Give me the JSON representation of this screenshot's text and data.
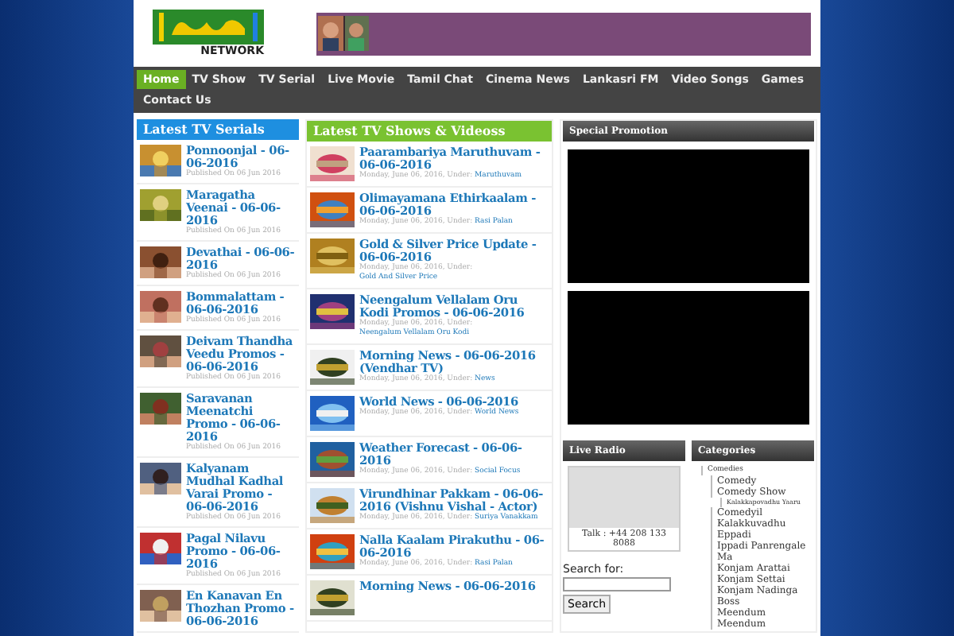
{
  "logo": {
    "subtitle": "NETWORK"
  },
  "nav": [
    {
      "label": "Home",
      "selected": true
    },
    {
      "label": "TV Show",
      "selected": false
    },
    {
      "label": "TV Serial",
      "selected": false
    },
    {
      "label": "Live Movie",
      "selected": false
    },
    {
      "label": "Tamil Chat",
      "selected": false
    },
    {
      "label": "Cinema News",
      "selected": false
    },
    {
      "label": "Lankasri FM",
      "selected": false
    },
    {
      "label": "Video Songs",
      "selected": false
    },
    {
      "label": "Games",
      "selected": false
    },
    {
      "label": "Contact Us",
      "selected": false
    }
  ],
  "serials": {
    "title": "Latest TV Serials",
    "items": [
      {
        "title": "Ponnoonjal - 06-06-2016",
        "date": "Published On 06 Jun 2016"
      },
      {
        "title": "Maragatha Veenai - 06-06-2016",
        "date": "Published On 06 Jun 2016"
      },
      {
        "title": "Devathai - 06-06-2016",
        "date": "Published On 06 Jun 2016"
      },
      {
        "title": "Bommalattam - 06-06-2016",
        "date": "Published On 06 Jun 2016"
      },
      {
        "title": "Deivam Thandha Veedu Promos - 06-06-2016",
        "date": "Published On 06 Jun 2016"
      },
      {
        "title": "Saravanan Meenatchi Promo - 06-06-2016",
        "date": "Published On 06 Jun 2016"
      },
      {
        "title": "Kalyanam Mudhal Kadhal Varai Promo - 06-06-2016",
        "date": "Published On 06 Jun 2016"
      },
      {
        "title": "Pagal Nilavu Promo - 06-06-2016",
        "date": "Published On 06 Jun 2016"
      },
      {
        "title": "En Kanavan En Thozhan Promo - 06-06-2016"
      }
    ]
  },
  "shows": {
    "title": "Latest TV Shows & Videoss",
    "items": [
      {
        "title": "Paarambariya Maruthuvam - 06-06-2016",
        "meta": "Monday, June 06, 2016, Under:",
        "category": "Maruthuvam"
      },
      {
        "title": "Olimayamana Ethirkaalam - 06-06-2016",
        "meta": "Monday, June 06, 2016, Under:",
        "category": "Rasi Palan"
      },
      {
        "title": "Gold & Silver Price Update - 06-06-2016",
        "meta": "Monday, June 06, 2016, Under:",
        "category": "Gold And Silver Price"
      },
      {
        "title": "Neengalum Vellalam Oru Kodi Promos - 06-06-2016",
        "meta": "Monday, June 06, 2016, Under:",
        "category": "Neengalum Vellalam Oru Kodi"
      },
      {
        "title": "Morning News - 06-06-2016 (Vendhar TV)",
        "meta": "Monday, June 06, 2016, Under:",
        "category": "News"
      },
      {
        "title": "World News - 06-06-2016",
        "meta": "Monday, June 06, 2016, Under:",
        "category": "World News"
      },
      {
        "title": "Weather Forecast - 06-06-2016",
        "meta": "Monday, June 06, 2016, Under:",
        "category": "Social Focus"
      },
      {
        "title": "Virundhinar Pakkam - 06-06-2016 (Vishnu Vishal - Actor)",
        "meta": "Monday, June 06, 2016, Under:",
        "category": "Suriya Vanakkam"
      },
      {
        "title": "Nalla Kaalam Pirakuthu - 06-06-2016",
        "meta": "Monday, June 06, 2016, Under:",
        "category": "Rasi Palan"
      },
      {
        "title": "Morning News - 06-06-2016"
      }
    ]
  },
  "promotion": {
    "title": "Special Promotion"
  },
  "radio": {
    "title": "Live Radio",
    "talk": "Talk : +44 208 133 8088"
  },
  "search": {
    "label": "Search for:",
    "button": "Search"
  },
  "categories": {
    "title": "Categories",
    "items": [
      {
        "label": "Comedies",
        "children": [
          {
            "label": "Comedy"
          },
          {
            "label": "Comedy Show",
            "children": [
              {
                "label": "Kalakkapovadhu Yaaru"
              }
            ]
          },
          {
            "label": "Comedyil Kalakkuvadhu Eppadi"
          },
          {
            "label": "Ippadi Panrengale Ma"
          },
          {
            "label": "Konjam Arattai Konjam Settai"
          },
          {
            "label": "Konjam Nadinga Boss"
          },
          {
            "label": "Meendum Meendum"
          }
        ]
      }
    ]
  }
}
